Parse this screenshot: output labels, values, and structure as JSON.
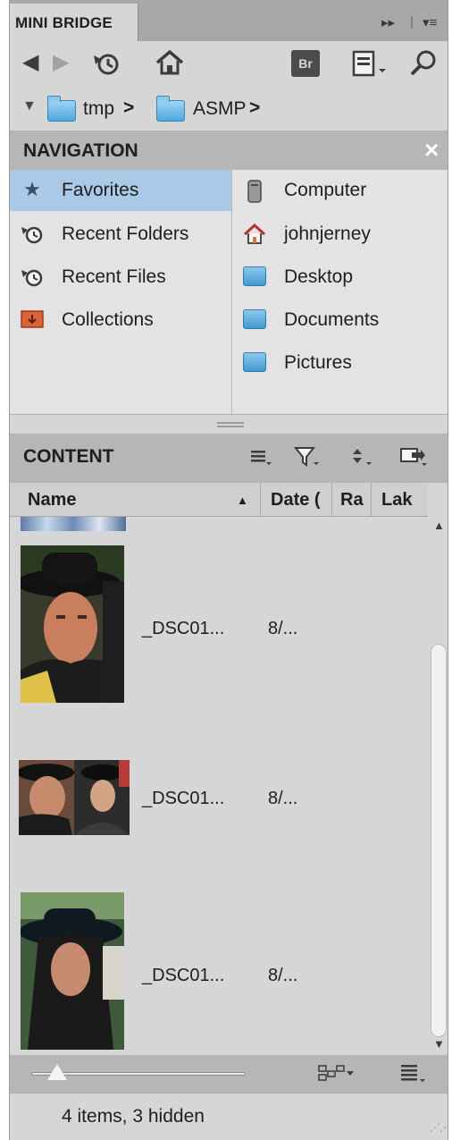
{
  "panel": {
    "tab_title": "MINI BRIDGE",
    "tab_controls": [
      "▸▸",
      "|",
      "▾≡"
    ]
  },
  "toolbar": {
    "back_icon": "back-arrow-icon",
    "forward_icon": "forward-arrow-icon",
    "recent_icon": "recent-history-icon",
    "home_icon": "home-icon",
    "bridge_button_label": "Br",
    "view_icon": "panel-view-icon",
    "search_icon": "search-icon"
  },
  "breadcrumb": {
    "items": [
      {
        "label": "tmp",
        "separator": ">"
      },
      {
        "label": "ASMP",
        "separator": ">"
      }
    ]
  },
  "navigation": {
    "title": "NAVIGATION",
    "close_glyph": "×",
    "left_items": [
      {
        "label": "Favorites",
        "icon": "star-icon",
        "selected": true
      },
      {
        "label": "Recent Folders",
        "icon": "recent-folders-icon",
        "selected": false
      },
      {
        "label": "Recent Files",
        "icon": "recent-files-icon",
        "selected": false
      },
      {
        "label": "Collections",
        "icon": "collections-icon",
        "selected": false
      }
    ],
    "right_items": [
      {
        "label": "Computer",
        "icon": "computer-icon"
      },
      {
        "label": "johnjerney",
        "icon": "home-folder-icon"
      },
      {
        "label": "Desktop",
        "icon": "desktop-folder-icon"
      },
      {
        "label": "Documents",
        "icon": "documents-folder-icon"
      },
      {
        "label": "Pictures",
        "icon": "pictures-folder-icon"
      }
    ]
  },
  "content": {
    "title": "CONTENT",
    "columns": [
      {
        "label": "Name",
        "sort": "▲"
      },
      {
        "label": "Date ("
      },
      {
        "label": "Ra"
      },
      {
        "label": "Lak"
      }
    ],
    "rows": [
      {
        "name": "_DSC01...",
        "date": "8/..."
      },
      {
        "name": "_DSC01...",
        "date": "8/..."
      },
      {
        "name": "_DSC01...",
        "date": "8/..."
      }
    ],
    "accent_color": "#a9c9e7"
  },
  "footer": {
    "thumbnail_size_fraction": 0.12,
    "status_text": "4 items, 3 hidden"
  }
}
